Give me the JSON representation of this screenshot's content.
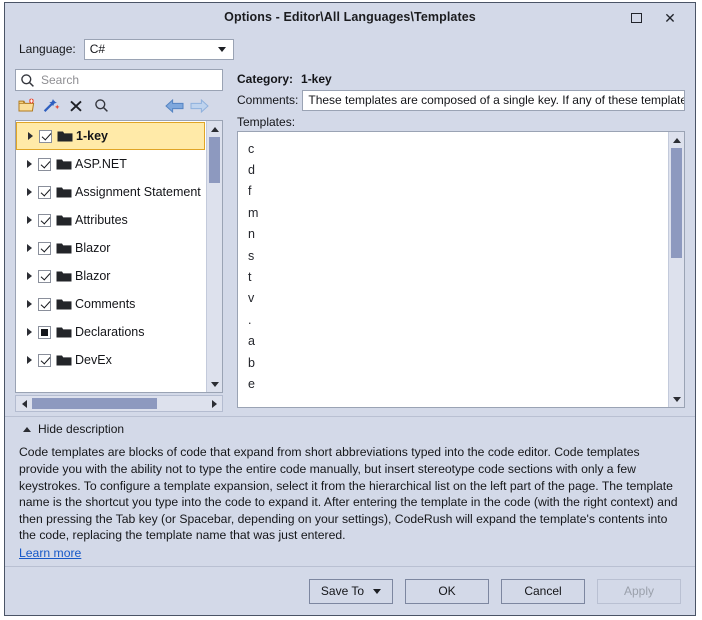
{
  "window": {
    "title": "Options - Editor\\All Languages\\Templates",
    "maximize_icon": "maximize-icon",
    "close_icon": "close-icon"
  },
  "language": {
    "label": "Language:",
    "value": "C#",
    "caret_icon": "chevron-down-icon"
  },
  "search": {
    "placeholder": "Search",
    "value": "",
    "icon": "search-icon"
  },
  "tree_toolbar": {
    "buttons": [
      {
        "name": "new-folder-button",
        "icon": "new-folder-icon"
      },
      {
        "name": "new-template-button",
        "icon": "magic-wand-icon"
      },
      {
        "name": "delete-button",
        "icon": "close-x-icon"
      },
      {
        "name": "find-button",
        "icon": "magnifier-icon"
      }
    ],
    "nav": [
      {
        "name": "back-button",
        "icon": "arrow-left-icon"
      },
      {
        "name": "forward-button",
        "icon": "arrow-right-icon"
      }
    ]
  },
  "tree": {
    "items": [
      {
        "label": "1-key",
        "check": "checked",
        "selected": true
      },
      {
        "label": "ASP.NET",
        "check": "checked",
        "selected": false
      },
      {
        "label": "Assignment Statement",
        "check": "checked",
        "selected": false
      },
      {
        "label": "Attributes",
        "check": "checked",
        "selected": false
      },
      {
        "label": "Blazor",
        "check": "checked",
        "selected": false
      },
      {
        "label": "Blazor",
        "check": "checked",
        "selected": false
      },
      {
        "label": "Comments",
        "check": "checked",
        "selected": false
      },
      {
        "label": "Declarations",
        "check": "partial",
        "selected": false
      },
      {
        "label": "DevEx",
        "check": "checked",
        "selected": false
      }
    ]
  },
  "details": {
    "category_label": "Category:",
    "category_value": "1-key",
    "comments_label": "Comments:",
    "comments_value": "These templates are composed of a single key. If any of these templates",
    "templates_label": "Templates:",
    "templates": [
      "c",
      "d",
      "f",
      "m",
      "n",
      "s",
      "t",
      "v",
      ".",
      "a",
      "b",
      "e"
    ]
  },
  "description": {
    "toggle_label": "Hide description",
    "toggle_icon": "chevron-up-icon",
    "text": "Code templates are blocks of code that expand from short abbreviations typed into the code editor. Code templates provide you with the ability not to type the entire code manually, but insert stereotype code sections with only a few keystrokes. To configure a template expansion, select it from the hierarchical list on the left part of the page. The template name is the shortcut you type into the code to expand it. After entering the template in the code (with the right context) and then pressing the Tab key (or Spacebar, depending on your settings), CodeRush will expand the template's contents into the code, replacing the template name that was just entered.",
    "link_label": "Learn more"
  },
  "footer": {
    "save_to_label": "Save To",
    "save_to_caret": "chevron-down-icon",
    "ok_label": "OK",
    "cancel_label": "Cancel",
    "apply_label": "Apply",
    "apply_disabled": true
  },
  "colors": {
    "dialog_background": "#d3d9e8",
    "selection_fill": "#ffeaa8",
    "selection_border": "#e0a526",
    "link": "#1658c8",
    "scrollbar_thumb": "#8d99bf",
    "field_background": "#ffffff"
  }
}
